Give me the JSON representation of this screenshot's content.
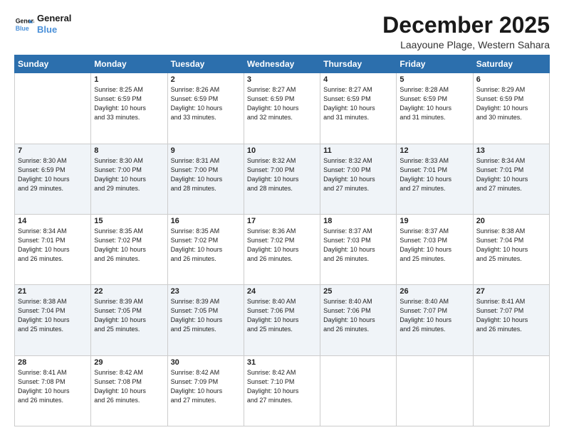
{
  "logo": {
    "line1": "General",
    "line2": "Blue"
  },
  "title": "December 2025",
  "location": "Laayoune Plage, Western Sahara",
  "days_of_week": [
    "Sunday",
    "Monday",
    "Tuesday",
    "Wednesday",
    "Thursday",
    "Friday",
    "Saturday"
  ],
  "weeks": [
    [
      {
        "day": "",
        "info": ""
      },
      {
        "day": "1",
        "info": "Sunrise: 8:25 AM\nSunset: 6:59 PM\nDaylight: 10 hours\nand 33 minutes."
      },
      {
        "day": "2",
        "info": "Sunrise: 8:26 AM\nSunset: 6:59 PM\nDaylight: 10 hours\nand 33 minutes."
      },
      {
        "day": "3",
        "info": "Sunrise: 8:27 AM\nSunset: 6:59 PM\nDaylight: 10 hours\nand 32 minutes."
      },
      {
        "day": "4",
        "info": "Sunrise: 8:27 AM\nSunset: 6:59 PM\nDaylight: 10 hours\nand 31 minutes."
      },
      {
        "day": "5",
        "info": "Sunrise: 8:28 AM\nSunset: 6:59 PM\nDaylight: 10 hours\nand 31 minutes."
      },
      {
        "day": "6",
        "info": "Sunrise: 8:29 AM\nSunset: 6:59 PM\nDaylight: 10 hours\nand 30 minutes."
      }
    ],
    [
      {
        "day": "7",
        "info": "Sunrise: 8:30 AM\nSunset: 6:59 PM\nDaylight: 10 hours\nand 29 minutes."
      },
      {
        "day": "8",
        "info": "Sunrise: 8:30 AM\nSunset: 7:00 PM\nDaylight: 10 hours\nand 29 minutes."
      },
      {
        "day": "9",
        "info": "Sunrise: 8:31 AM\nSunset: 7:00 PM\nDaylight: 10 hours\nand 28 minutes."
      },
      {
        "day": "10",
        "info": "Sunrise: 8:32 AM\nSunset: 7:00 PM\nDaylight: 10 hours\nand 28 minutes."
      },
      {
        "day": "11",
        "info": "Sunrise: 8:32 AM\nSunset: 7:00 PM\nDaylight: 10 hours\nand 27 minutes."
      },
      {
        "day": "12",
        "info": "Sunrise: 8:33 AM\nSunset: 7:01 PM\nDaylight: 10 hours\nand 27 minutes."
      },
      {
        "day": "13",
        "info": "Sunrise: 8:34 AM\nSunset: 7:01 PM\nDaylight: 10 hours\nand 27 minutes."
      }
    ],
    [
      {
        "day": "14",
        "info": "Sunrise: 8:34 AM\nSunset: 7:01 PM\nDaylight: 10 hours\nand 26 minutes."
      },
      {
        "day": "15",
        "info": "Sunrise: 8:35 AM\nSunset: 7:02 PM\nDaylight: 10 hours\nand 26 minutes."
      },
      {
        "day": "16",
        "info": "Sunrise: 8:35 AM\nSunset: 7:02 PM\nDaylight: 10 hours\nand 26 minutes."
      },
      {
        "day": "17",
        "info": "Sunrise: 8:36 AM\nSunset: 7:02 PM\nDaylight: 10 hours\nand 26 minutes."
      },
      {
        "day": "18",
        "info": "Sunrise: 8:37 AM\nSunset: 7:03 PM\nDaylight: 10 hours\nand 26 minutes."
      },
      {
        "day": "19",
        "info": "Sunrise: 8:37 AM\nSunset: 7:03 PM\nDaylight: 10 hours\nand 25 minutes."
      },
      {
        "day": "20",
        "info": "Sunrise: 8:38 AM\nSunset: 7:04 PM\nDaylight: 10 hours\nand 25 minutes."
      }
    ],
    [
      {
        "day": "21",
        "info": "Sunrise: 8:38 AM\nSunset: 7:04 PM\nDaylight: 10 hours\nand 25 minutes."
      },
      {
        "day": "22",
        "info": "Sunrise: 8:39 AM\nSunset: 7:05 PM\nDaylight: 10 hours\nand 25 minutes."
      },
      {
        "day": "23",
        "info": "Sunrise: 8:39 AM\nSunset: 7:05 PM\nDaylight: 10 hours\nand 25 minutes."
      },
      {
        "day": "24",
        "info": "Sunrise: 8:40 AM\nSunset: 7:06 PM\nDaylight: 10 hours\nand 25 minutes."
      },
      {
        "day": "25",
        "info": "Sunrise: 8:40 AM\nSunset: 7:06 PM\nDaylight: 10 hours\nand 26 minutes."
      },
      {
        "day": "26",
        "info": "Sunrise: 8:40 AM\nSunset: 7:07 PM\nDaylight: 10 hours\nand 26 minutes."
      },
      {
        "day": "27",
        "info": "Sunrise: 8:41 AM\nSunset: 7:07 PM\nDaylight: 10 hours\nand 26 minutes."
      }
    ],
    [
      {
        "day": "28",
        "info": "Sunrise: 8:41 AM\nSunset: 7:08 PM\nDaylight: 10 hours\nand 26 minutes."
      },
      {
        "day": "29",
        "info": "Sunrise: 8:42 AM\nSunset: 7:08 PM\nDaylight: 10 hours\nand 26 minutes."
      },
      {
        "day": "30",
        "info": "Sunrise: 8:42 AM\nSunset: 7:09 PM\nDaylight: 10 hours\nand 27 minutes."
      },
      {
        "day": "31",
        "info": "Sunrise: 8:42 AM\nSunset: 7:10 PM\nDaylight: 10 hours\nand 27 minutes."
      },
      {
        "day": "",
        "info": ""
      },
      {
        "day": "",
        "info": ""
      },
      {
        "day": "",
        "info": ""
      }
    ]
  ]
}
